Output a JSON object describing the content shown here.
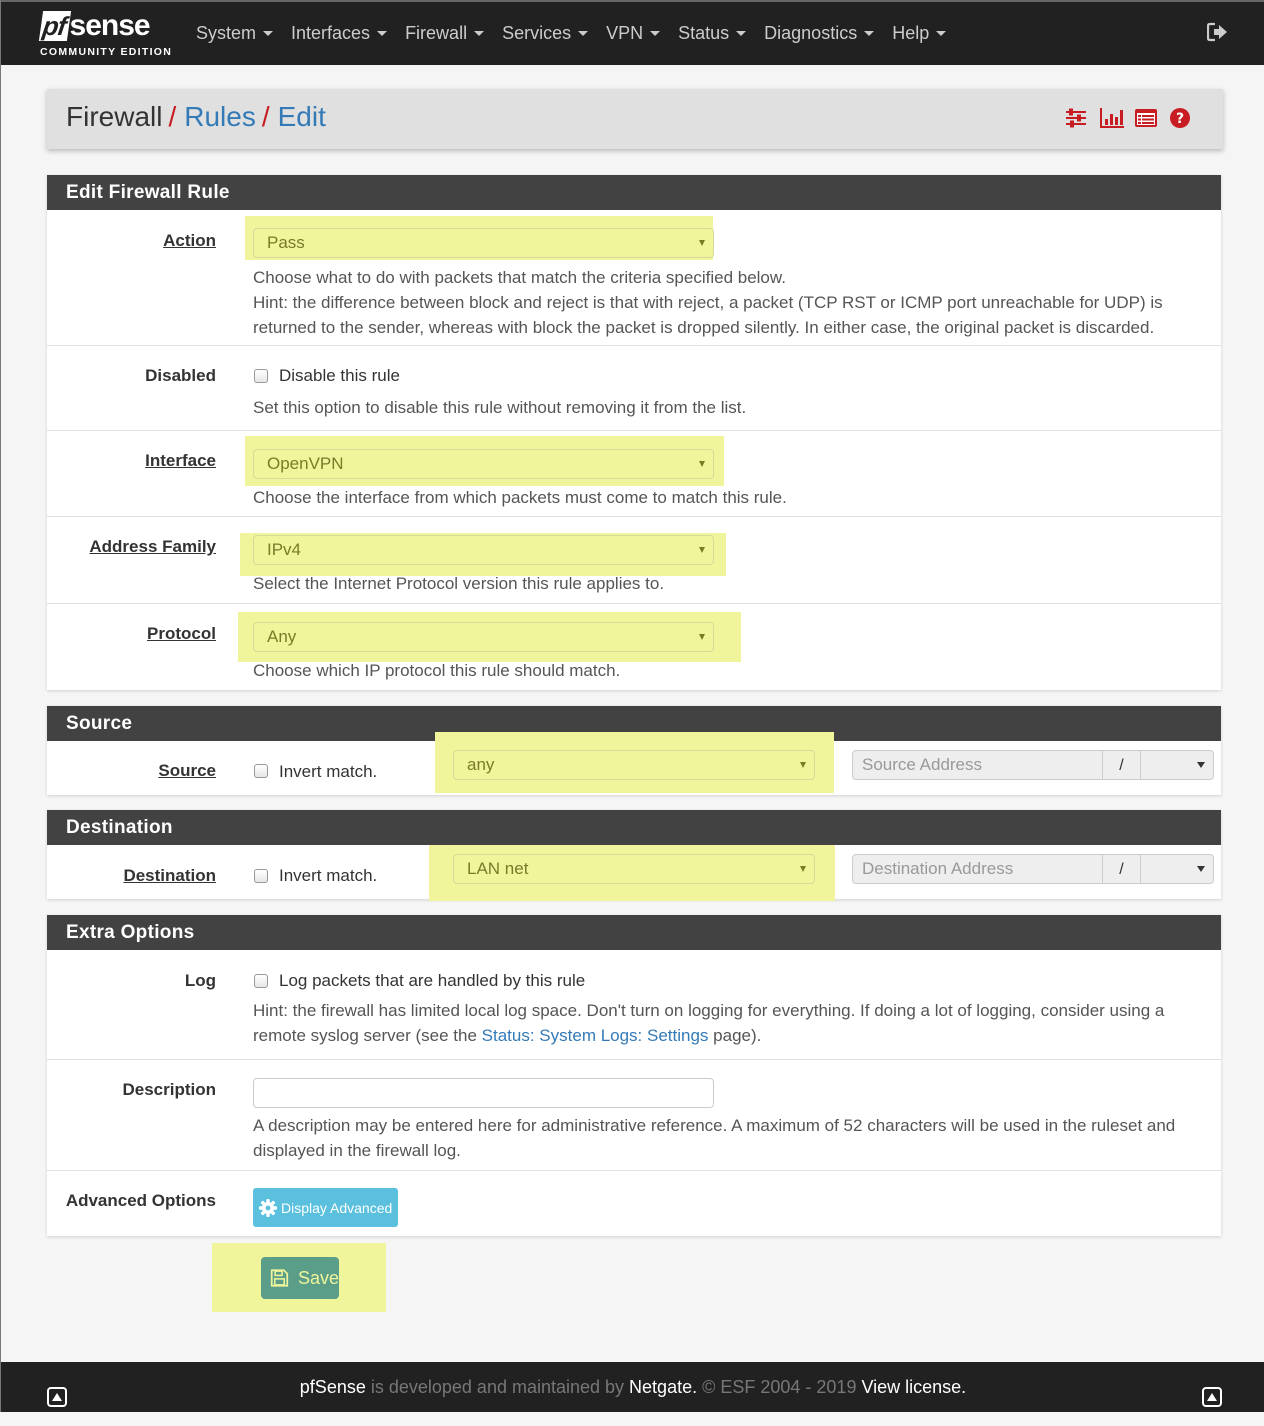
{
  "brand": {
    "logo_pf": "pf",
    "logo_sense": "sense",
    "subtitle": "COMMUNITY EDITION"
  },
  "nav": {
    "items": [
      {
        "label": "System"
      },
      {
        "label": "Interfaces"
      },
      {
        "label": "Firewall"
      },
      {
        "label": "Services"
      },
      {
        "label": "VPN"
      },
      {
        "label": "Status"
      },
      {
        "label": "Diagnostics"
      },
      {
        "label": "Help"
      }
    ],
    "logout_icon": "sign-out-icon"
  },
  "breadcrumb": {
    "items": [
      "Firewall",
      "Rules",
      "Edit"
    ],
    "separator": "/",
    "icons": [
      "sliders-icon",
      "bar-chart-icon",
      "list-alt-icon",
      "question-circle-icon"
    ]
  },
  "edit_rule": {
    "heading": "Edit Firewall Rule",
    "action": {
      "label": "Action",
      "value": "Pass",
      "help_lines": [
        "Choose what to do with packets that match the criteria specified below.",
        "Hint: the difference between block and reject is that with reject, a packet (TCP RST or ICMP port unreachable for UDP) is returned to the sender, whereas with block the packet is dropped silently. In either case, the original packet is discarded."
      ]
    },
    "disabled": {
      "label": "Disabled",
      "checkbox_label": "Disable this rule",
      "checked": false,
      "help": "Set this option to disable this rule without removing it from the list."
    },
    "interface": {
      "label": "Interface",
      "value": "OpenVPN",
      "help": "Choose the interface from which packets must come to match this rule."
    },
    "address_family": {
      "label": "Address Family",
      "value": "IPv4",
      "help": "Select the Internet Protocol version this rule applies to."
    },
    "protocol": {
      "label": "Protocol",
      "value": "Any",
      "help": "Choose which IP protocol this rule should match."
    }
  },
  "source": {
    "heading": "Source",
    "label": "Source",
    "invert_label": "Invert match.",
    "invert_checked": false,
    "type_value": "any",
    "address_placeholder": "Source Address",
    "slash": "/",
    "mask_value": ""
  },
  "destination": {
    "heading": "Destination",
    "label": "Destination",
    "invert_label": "Invert match.",
    "invert_checked": false,
    "type_value": "LAN net",
    "address_placeholder": "Destination Address",
    "slash": "/",
    "mask_value": ""
  },
  "extra": {
    "heading": "Extra Options",
    "log": {
      "label": "Log",
      "checkbox_label": "Log packets that are handled by this rule",
      "checked": false,
      "help_prefix": "Hint: the firewall has limited local log space. Don't turn on logging for everything. If doing a lot of logging, consider using a remote syslog server (see the ",
      "help_link": "Status: System Logs: Settings",
      "help_suffix": " page)."
    },
    "description": {
      "label": "Description",
      "value": "",
      "help": "A description may be entered here for administrative reference. A maximum of 52 characters will be used in the ruleset and displayed in the firewall log."
    },
    "advanced": {
      "label": "Advanced Options",
      "button_label": "Display Advanced"
    }
  },
  "save_label": "Save",
  "footer": {
    "product": "pfSense",
    "text1": " is developed and maintained by ",
    "company": "Netgate.",
    "text2": " © ESF 2004 - 2019 ",
    "license_link": "View license."
  },
  "colors": {
    "navbar": "#212121",
    "panel_heading": "#424242",
    "accent_red": "#c71c22",
    "link_blue": "#337ab7",
    "highlight": "#f0f59b",
    "info_button": "#5bc0de",
    "save_button": "#5a9e8a"
  }
}
